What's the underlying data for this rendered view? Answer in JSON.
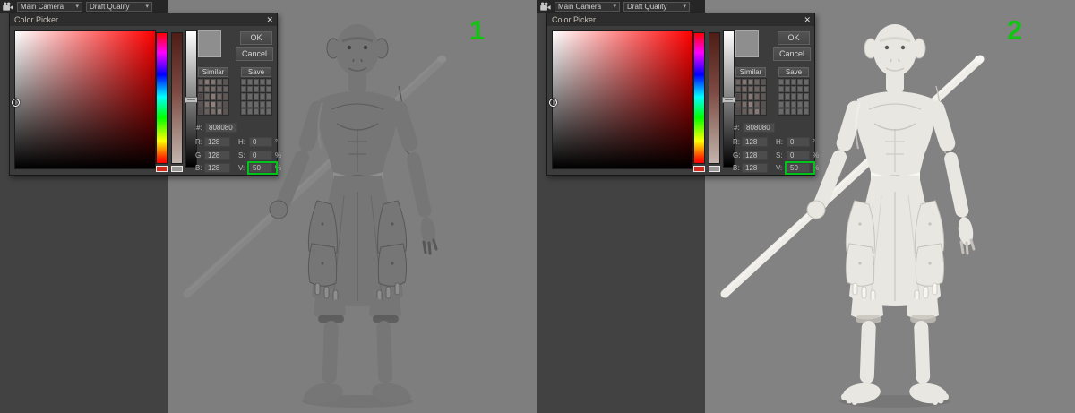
{
  "icons": {
    "dropdown": "▾",
    "close": "✕"
  },
  "panels": [
    {
      "label": "1",
      "toolbar": {
        "camera": "Main Camera",
        "quality": "Draft Quality"
      },
      "render": {
        "base_color": "#767676",
        "highlight_color": "#8e8e8e",
        "shadow_color": "#575757",
        "line_color": "#474747",
        "staff_color": "#868686",
        "background_color": "#7e7e7e"
      },
      "color_picker": {
        "title": "Color Picker",
        "ok": "OK",
        "cancel": "Cancel",
        "similar": "Similar",
        "save": "Save",
        "hex_label": "#:",
        "hex_value": "808080",
        "r_label": "R:",
        "r_value": "128",
        "g_label": "G:",
        "g_value": "128",
        "b_label": "B:",
        "b_value": "128",
        "h_label": "H:",
        "h_value": "0",
        "h_unit": "°",
        "s_label": "S:",
        "s_value": "0",
        "s_unit": "%",
        "v_label": "V:",
        "v_value": "50",
        "v_unit": "%",
        "v_highlight_color": "#00c41c",
        "similar_swatches": [
          "#6f6361",
          "#8a7572",
          "#7e7471",
          "#6e6361",
          "#5b5553",
          "#6b5f5d",
          "#7b6b67",
          "#776b69",
          "#6f6361",
          "#6a605e",
          "#4f4846",
          "#6f6260",
          "#8a7a76",
          "#756562",
          "#615755",
          "#5d5452",
          "#806e6a",
          "#91807c",
          "#6d615f",
          "#595150",
          "#51494a",
          "#6a5e5c",
          "#7b6d69",
          "#887a75",
          "#5e5655"
        ],
        "saved_swatches": [
          "#696969",
          "#696969",
          "#696969",
          "#696969",
          "#696969",
          "#696969",
          "#696969",
          "#696969",
          "#696969",
          "#696969",
          "#696969",
          "#696969",
          "#696969",
          "#696969",
          "#696969",
          "#696969",
          "#696969",
          "#696969",
          "#696969",
          "#696969",
          "#696969",
          "#696969",
          "#696969",
          "#696969",
          "#696969"
        ]
      }
    },
    {
      "label": "2",
      "toolbar": {
        "camera": "Main Camera",
        "quality": "Draft Quality"
      },
      "render": {
        "base_color": "#e9e7e2",
        "highlight_color": "#f7f6f3",
        "shadow_color": "#c6c2bb",
        "line_color": "#aaa69e",
        "staff_color": "#efede8",
        "background_color": "#828282"
      },
      "color_picker": {
        "title": "Color Picker",
        "ok": "OK",
        "cancel": "Cancel",
        "similar": "Similar",
        "save": "Save",
        "hex_label": "#:",
        "hex_value": "808080",
        "r_label": "R:",
        "r_value": "128",
        "g_label": "G:",
        "g_value": "128",
        "b_label": "B:",
        "b_value": "128",
        "h_label": "H:",
        "h_value": "0",
        "h_unit": "°",
        "s_label": "S:",
        "s_value": "0",
        "s_unit": "%",
        "v_label": "V:",
        "v_value": "50",
        "v_unit": "%",
        "v_highlight_color": "#00c41c",
        "similar_swatches": [
          "#6f6361",
          "#8a7572",
          "#7e7471",
          "#6e6361",
          "#5b5553",
          "#6b5f5d",
          "#7b6b67",
          "#776b69",
          "#6f6361",
          "#6a605e",
          "#4f4846",
          "#6f6260",
          "#8a7a76",
          "#756562",
          "#615755",
          "#5d5452",
          "#806e6a",
          "#91807c",
          "#6d615f",
          "#595150",
          "#51494a",
          "#6a5e5c",
          "#7b6d69",
          "#887a75",
          "#5e5655"
        ],
        "saved_swatches": [
          "#696969",
          "#696969",
          "#696969",
          "#696969",
          "#696969",
          "#696969",
          "#696969",
          "#696969",
          "#696969",
          "#696969",
          "#696969",
          "#696969",
          "#696969",
          "#696969",
          "#696969",
          "#696969",
          "#696969",
          "#696969",
          "#696969",
          "#696969",
          "#696969",
          "#696969",
          "#696969",
          "#696969",
          "#696969"
        ]
      }
    }
  ]
}
